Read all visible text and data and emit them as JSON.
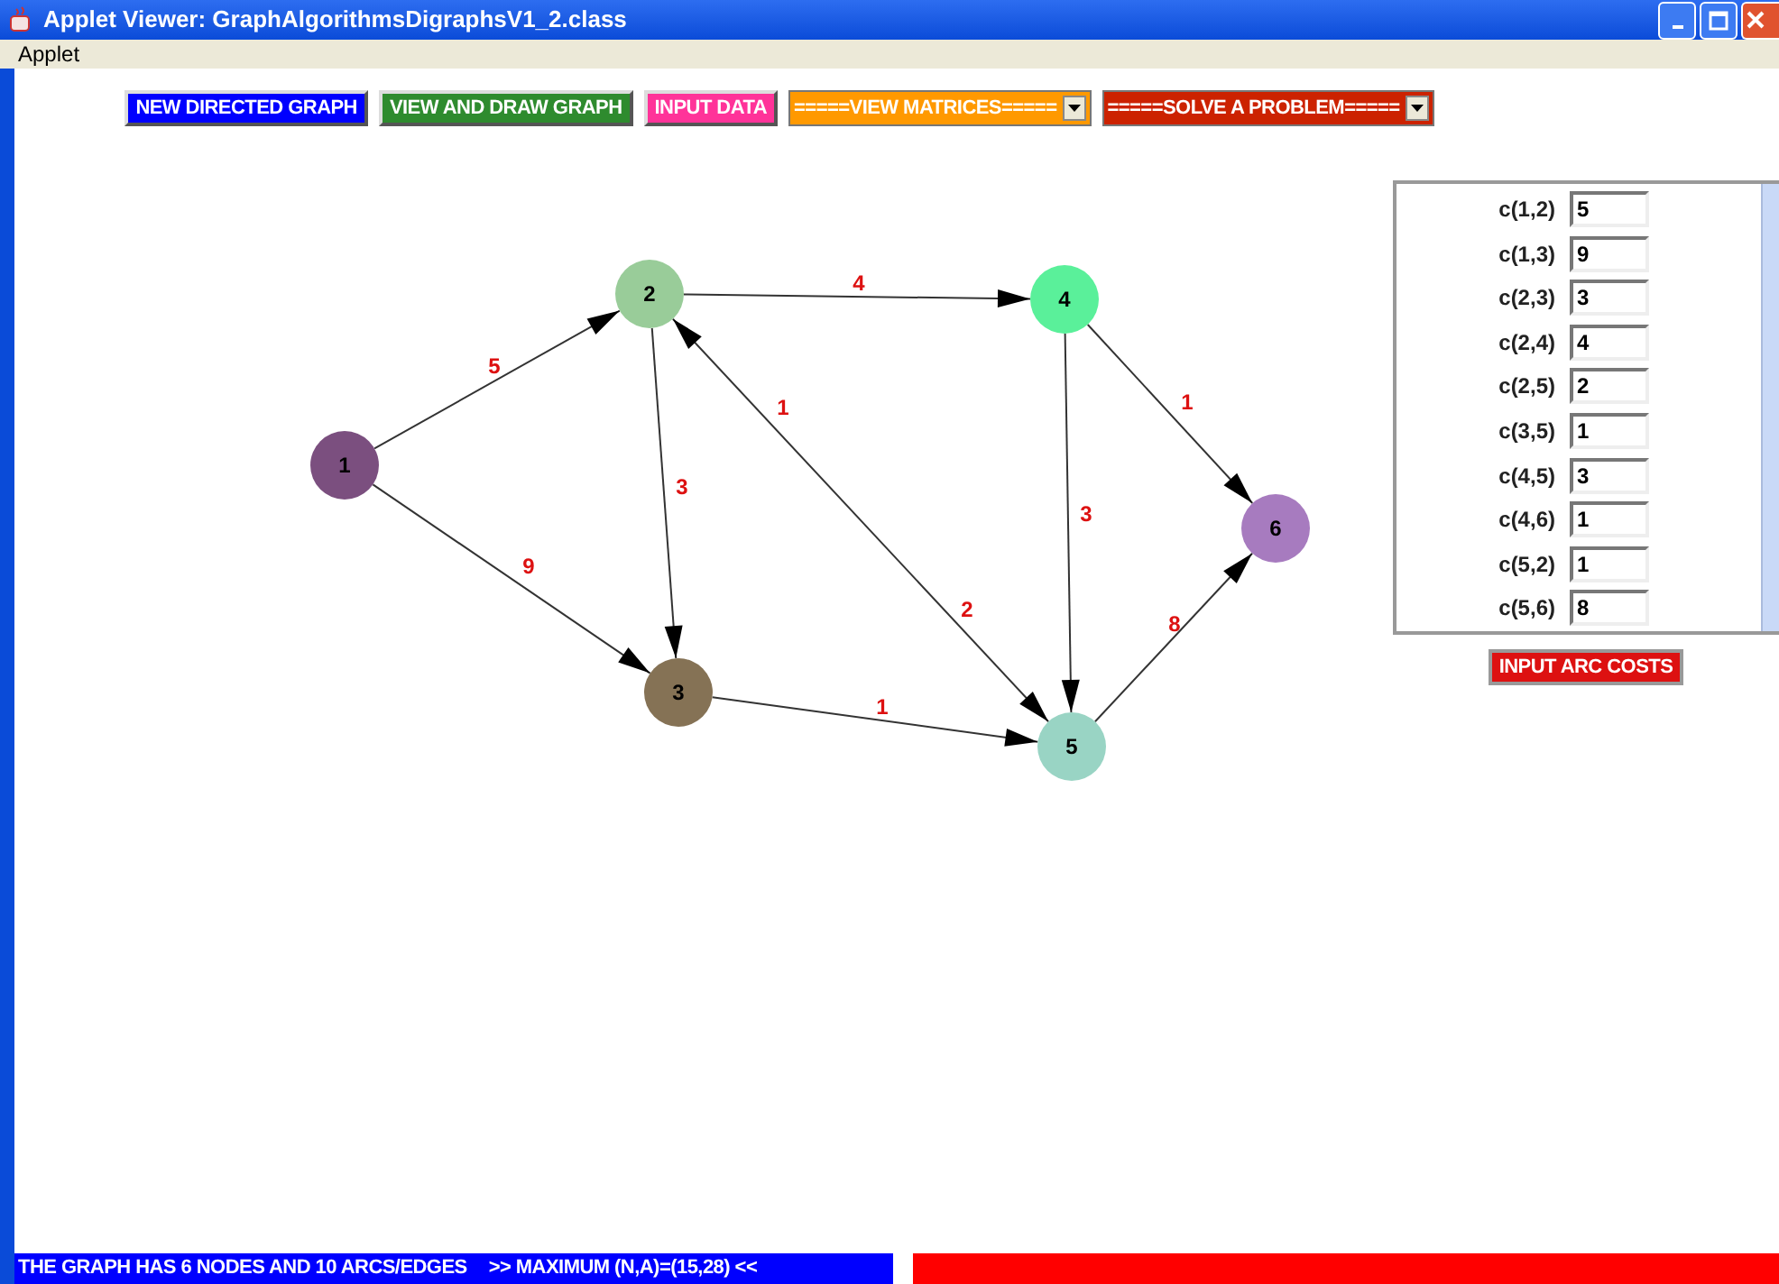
{
  "window": {
    "title": "Applet Viewer: GraphAlgorithmsDigraphsV1_2.class"
  },
  "menu": [
    "Applet"
  ],
  "toolbar": [
    {
      "kind": "button",
      "label": "NEW DIRECTED GRAPH",
      "color": "#0000ff"
    },
    {
      "kind": "button",
      "label": "VIEW AND DRAW GRAPH",
      "color": "#2e8b2e"
    },
    {
      "kind": "button",
      "label": "INPUT DATA",
      "color": "#ff3399"
    },
    {
      "kind": "dropdown",
      "label": "=====VIEW MATRICES=====",
      "color": "#ff9900"
    },
    {
      "kind": "dropdown",
      "label": "=====SOLVE A PROBLEM=====",
      "color": "#cc2200"
    }
  ],
  "graph": {
    "nodes": [
      {
        "label": "1",
        "color": "#7b4f7f"
      },
      {
        "label": "2",
        "color": "#99cc99"
      },
      {
        "label": "3",
        "color": "#857255"
      },
      {
        "label": "4",
        "color": "#5af09a"
      },
      {
        "label": "5",
        "color": "#99d4c4"
      },
      {
        "label": "6",
        "color": "#a77bbf"
      }
    ],
    "arcs": [
      {
        "cost": "5"
      },
      {
        "cost": "9"
      },
      {
        "cost": "4"
      },
      {
        "cost": "3"
      },
      {
        "cost": "2"
      },
      {
        "cost": "1"
      },
      {
        "cost": "3"
      },
      {
        "cost": "1"
      },
      {
        "cost": "1"
      },
      {
        "cost": "8"
      }
    ]
  },
  "arc_costs": [
    {
      "label": "c(1,2)",
      "value": "5"
    },
    {
      "label": "c(1,3)",
      "value": "9"
    },
    {
      "label": "c(2,3)",
      "value": "3"
    },
    {
      "label": "c(2,4)",
      "value": "4"
    },
    {
      "label": "c(2,5)",
      "value": "2"
    },
    {
      "label": "c(3,5)",
      "value": "1"
    },
    {
      "label": "c(4,5)",
      "value": "3"
    },
    {
      "label": "c(4,6)",
      "value": "1"
    },
    {
      "label": "c(5,2)",
      "value": "1"
    },
    {
      "label": "c(5,6)",
      "value": "8"
    }
  ],
  "input_button": "INPUT ARC COSTS",
  "status_bar": {
    "message": "THE GRAPH HAS 6 NODES AND 10 ARCS/EDGES",
    "limit": ">> MAXIMUM (N,A)=(15,28) <<"
  }
}
